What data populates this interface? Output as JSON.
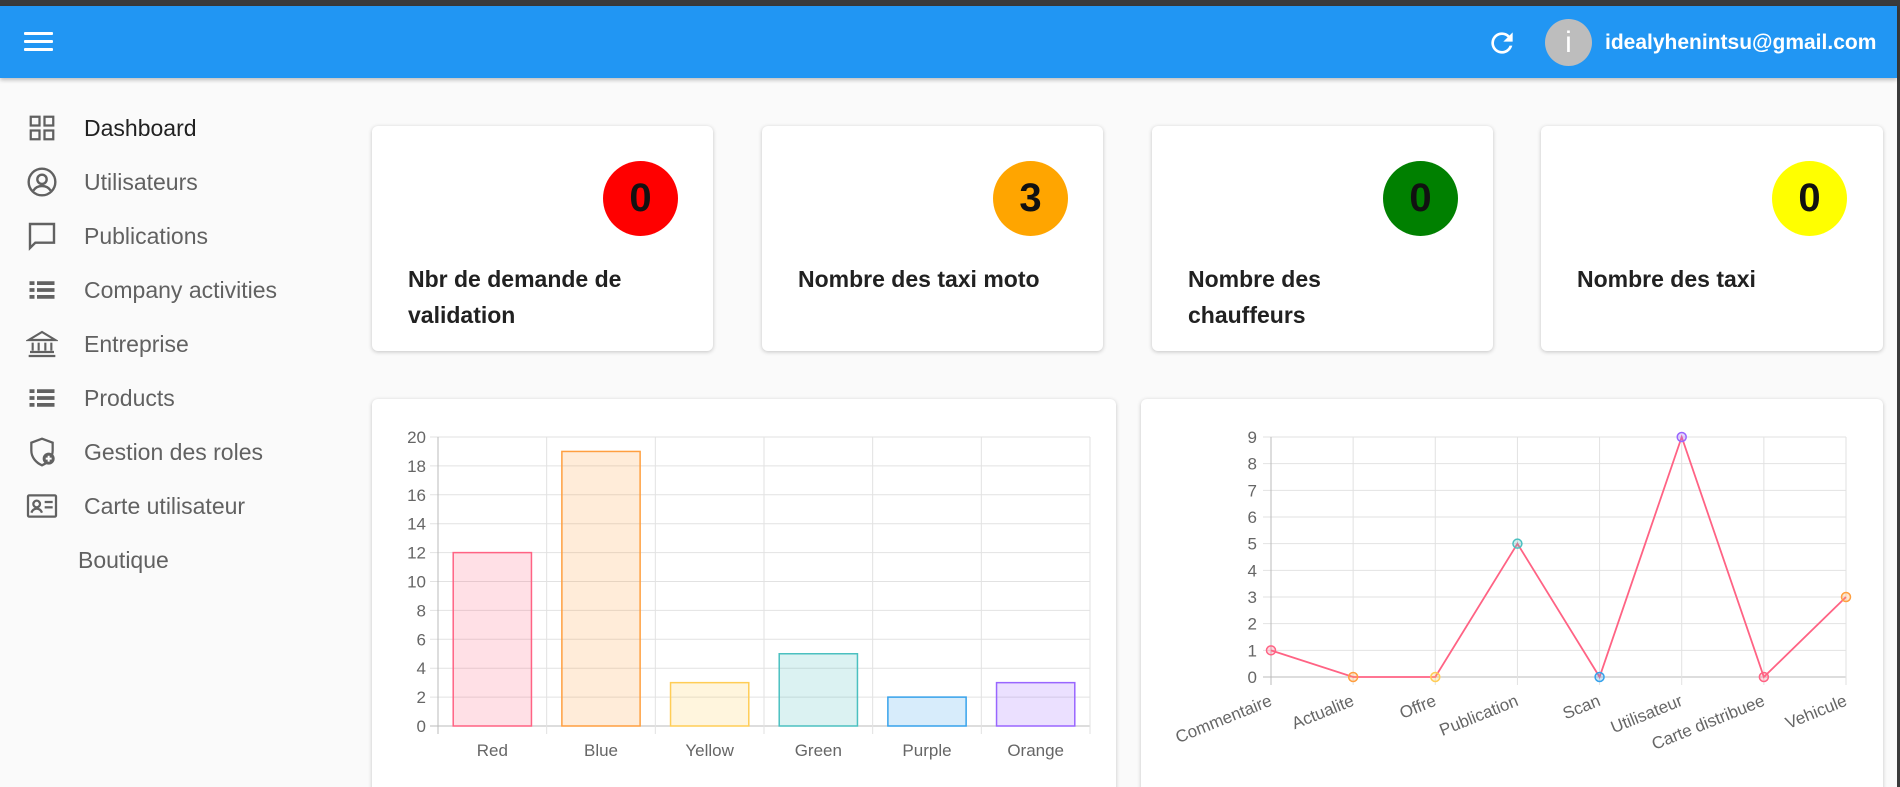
{
  "header": {
    "user_avatar_letter": "i",
    "user_email": "idealyhenintsu@gmail.com"
  },
  "sidebar": {
    "items": [
      {
        "label": "Dashboard",
        "icon": "dashboard-grid-icon"
      },
      {
        "label": "Utilisateurs",
        "icon": "account-circle-icon"
      },
      {
        "label": "Publications",
        "icon": "chat-bubble-icon"
      },
      {
        "label": "Company activities",
        "icon": "list-icon"
      },
      {
        "label": "Entreprise",
        "icon": "bank-icon"
      },
      {
        "label": "Products",
        "icon": "list-icon"
      },
      {
        "label": "Gestion des roles",
        "icon": "shield-plus-icon"
      },
      {
        "label": "Carte utilisateur",
        "icon": "contact-card-icon"
      },
      {
        "label": "Boutique",
        "icon": ""
      }
    ]
  },
  "stats": [
    {
      "value": "0",
      "label": "Nbr de demande de validation",
      "color": "#ff0000"
    },
    {
      "value": "3",
      "label": "Nombre des taxi moto",
      "color": "#ffa500"
    },
    {
      "value": "0",
      "label": "Nombre des chauffeurs",
      "color": "#008000"
    },
    {
      "value": "0",
      "label": "Nombre des taxi",
      "color": "#ffff00"
    }
  ],
  "chart_data": [
    {
      "type": "bar",
      "categories": [
        "Red",
        "Blue",
        "Yellow",
        "Green",
        "Purple",
        "Orange"
      ],
      "values": [
        12,
        19,
        3,
        5,
        2,
        3
      ],
      "ylim": [
        0,
        20
      ],
      "yticks": [
        0,
        2,
        4,
        6,
        8,
        10,
        12,
        14,
        16,
        18,
        20
      ],
      "grid": true,
      "colors": [
        "#ff6384",
        "#ff9f40",
        "#ffcd56",
        "#4bc0c0",
        "#36a2eb",
        "#9966ff"
      ]
    },
    {
      "type": "line",
      "categories": [
        "Commentaire",
        "Actualite",
        "Offre",
        "Publication",
        "Scan",
        "Utilisateur",
        "Carte distribuee",
        "Vehicule"
      ],
      "values": [
        1,
        0,
        0,
        5,
        0,
        9,
        0,
        3
      ],
      "ylim": [
        0,
        9
      ],
      "yticks": [
        0,
        1,
        2,
        3,
        4,
        5,
        6,
        7,
        8,
        9
      ],
      "grid": true,
      "line_color": "#ff6384",
      "point_colors": [
        "#ff6384",
        "#ff9f40",
        "#ffcd56",
        "#4bc0c0",
        "#36a2eb",
        "#9966ff",
        "#ff6384",
        "#ff9f40"
      ]
    }
  ]
}
